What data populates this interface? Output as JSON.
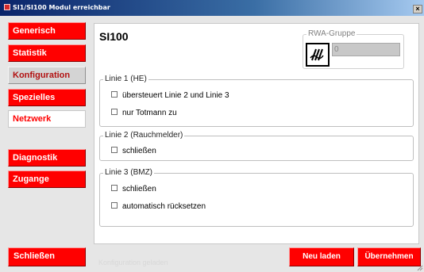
{
  "window": {
    "title": "SI1/SI100 Modul erreichbar",
    "close_glyph": "×"
  },
  "sidebar": {
    "items": [
      {
        "label": "Generisch"
      },
      {
        "label": "Statistik"
      },
      {
        "label": "Konfiguration"
      },
      {
        "label": "Spezielles"
      },
      {
        "label": "Netzwerk"
      },
      {
        "label": "Diagnostik"
      },
      {
        "label": "Zugange"
      }
    ],
    "close_label": "Schließen"
  },
  "content": {
    "title": "SI100",
    "rwa": {
      "legend": "RWA-Gruppe",
      "value": "0",
      "icon": "signal-wave-icon"
    },
    "line1": {
      "legend": "Linie 1 (HE)",
      "options": [
        {
          "label": "übersteuert Linie 2 und Linie 3",
          "checked": false
        },
        {
          "label": "nur Totmann zu",
          "checked": false
        }
      ]
    },
    "line2": {
      "legend": "Linie 2 (Rauchmelder)",
      "options": [
        {
          "label": "schließen",
          "checked": false
        }
      ]
    },
    "line3": {
      "legend": "Linie 3 (BMZ)",
      "options": [
        {
          "label": "schließen",
          "checked": false
        },
        {
          "label": "automatisch rücksetzen",
          "checked": false
        }
      ]
    }
  },
  "footer": {
    "status": "Konfiguration geladen",
    "reload_label": "Neu laden",
    "apply_label": "Übernehmen"
  },
  "colors": {
    "accent": "#ff0000",
    "titlebar": "#0a246a",
    "background": "#e6e6e6"
  }
}
